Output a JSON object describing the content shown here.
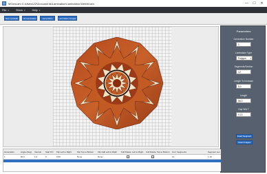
{
  "window": {
    "title": "MGenLam  C:\\Users\\ZZ\\Documents\\Lamination\\Lamination.Welcht.lam",
    "buttons": [
      "—",
      "☐",
      "✕"
    ]
  },
  "menu": {
    "items": [
      {
        "label": "File"
      },
      {
        "label": "Show"
      },
      {
        "label": "Help"
      }
    ],
    "caret": "▾"
  },
  "toolbar": {
    "buttons": [
      {
        "label": "New Lamlaffo"
      },
      {
        "label": "Lib Lamination"
      },
      {
        "label": "Generation"
      },
      {
        "label": "Lamination Images"
      }
    ]
  },
  "panel": {
    "title": "Parameters",
    "generation_number_label": "Generation Number",
    "generation_number_value": "1",
    "lamination_type_label": "Lamination Type",
    "lamination_type_value": "Polygon",
    "segments_label": "Segments/Section",
    "segments_value": "12",
    "length_label": "Length To Increase",
    "length_value": "5.0",
    "length2_label": "Length",
    "length2_value": "56.0",
    "gapwidth_label": "Gap Wid T",
    "gapwidth_value": "0.13",
    "insert_segment_label": "Insert Segment",
    "insert_images_label": "Insert Images"
  },
  "table": {
    "headers": [
      "Generation",
      "Angle (Deg)",
      "Interval",
      "Start Pct",
      "Flip Left to Right",
      "Flip Top to Bottom",
      "Flip Half Left to Right",
      "Full Rotate",
      "Left to Right",
      "Full Rotate",
      "Top to Bottom",
      "Curr. Segments",
      "Segment Len"
    ],
    "row": [
      "1",
      "60.0",
      "1.0",
      "0",
      "0.60",
      "None",
      "None",
      "",
      "",
      "",
      "",
      "12",
      "1.16"
    ]
  },
  "colors": {
    "menubar": "#2e3135",
    "accent_button": "#2f6fc2",
    "panel": "#5a6270",
    "wood_dark": "#8a2e12",
    "wood_mid": "#c25a24",
    "cream": "#f3e3c4"
  }
}
